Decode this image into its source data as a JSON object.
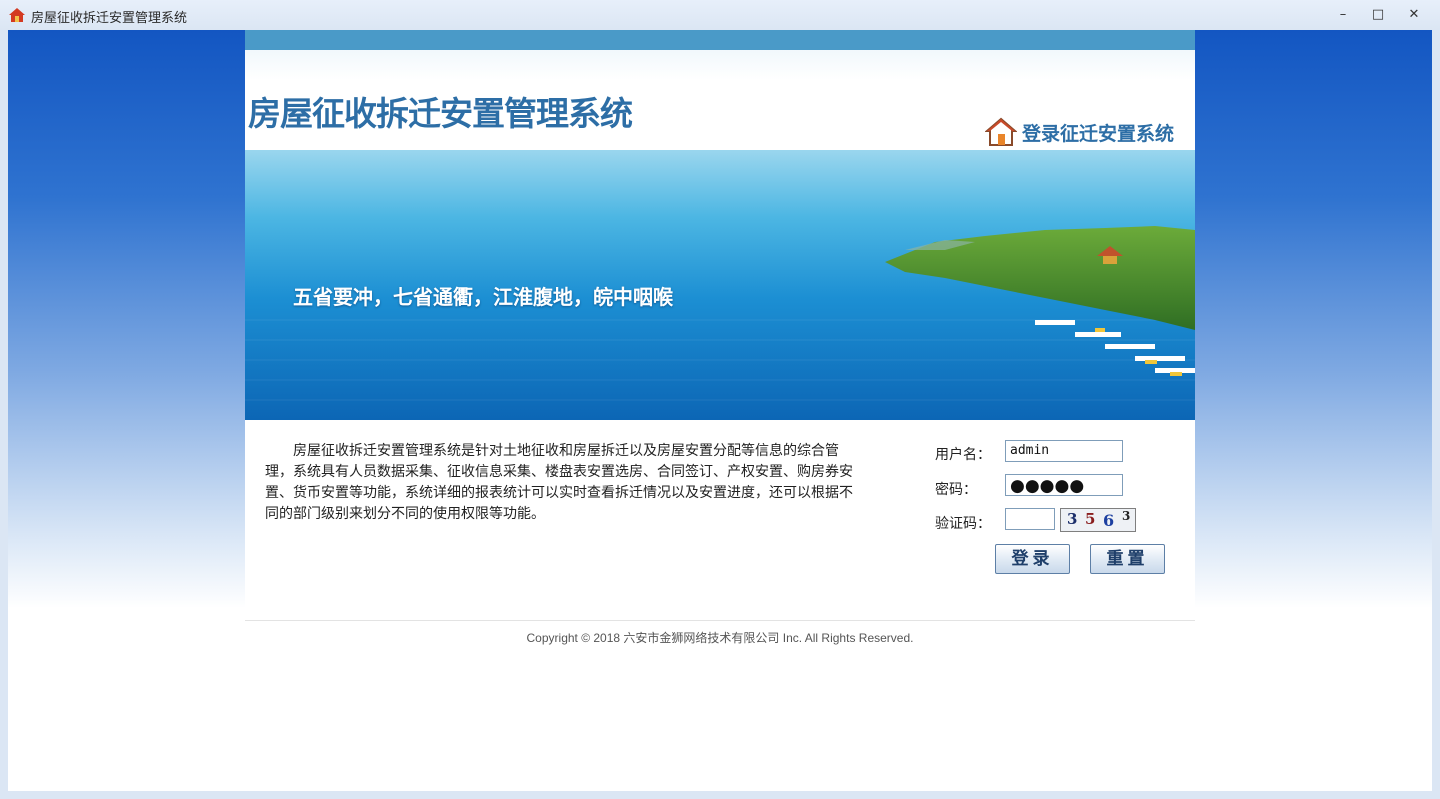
{
  "window": {
    "title": "房屋征收拆迁安置管理系统",
    "controls": {
      "minimize": "–",
      "maximize": "□",
      "close": "✕"
    }
  },
  "header": {
    "system_title": "房屋征收拆迁安置管理系统",
    "login_link": "登录征迁安置系统"
  },
  "banner": {
    "slogan": "五省要冲，七省通衢，江淮腹地，皖中咽喉"
  },
  "description": "房屋征收拆迁安置管理系统是针对土地征收和房屋拆迁以及房屋安置分配等信息的综合管理，系统具有人员数据采集、征收信息采集、楼盘表安置选房、合同签订、产权安置、购房券安置、货币安置等功能，系统详细的报表统计可以实时查看拆迁情况以及安置进度，还可以根据不同的部门级别来划分不同的使用权限等功能。",
  "login_form": {
    "username_label": "用户名：",
    "username_value": "admin",
    "password_label": "密码：",
    "password_value": "●●●●●",
    "captcha_label": "验证码：",
    "captcha_value": "",
    "captcha_image_text": [
      "3",
      "5",
      "6",
      "3"
    ],
    "login_button": "登录",
    "reset_button": "重置"
  },
  "footer": {
    "copyright": "Copyright © 2018 六安市金狮网络技术有限公司 Inc. All Rights Reserved."
  },
  "colors": {
    "brand_blue": "#2d6ea6",
    "topbar": "#4a9ac8",
    "button_text": "#1f3f6a"
  }
}
